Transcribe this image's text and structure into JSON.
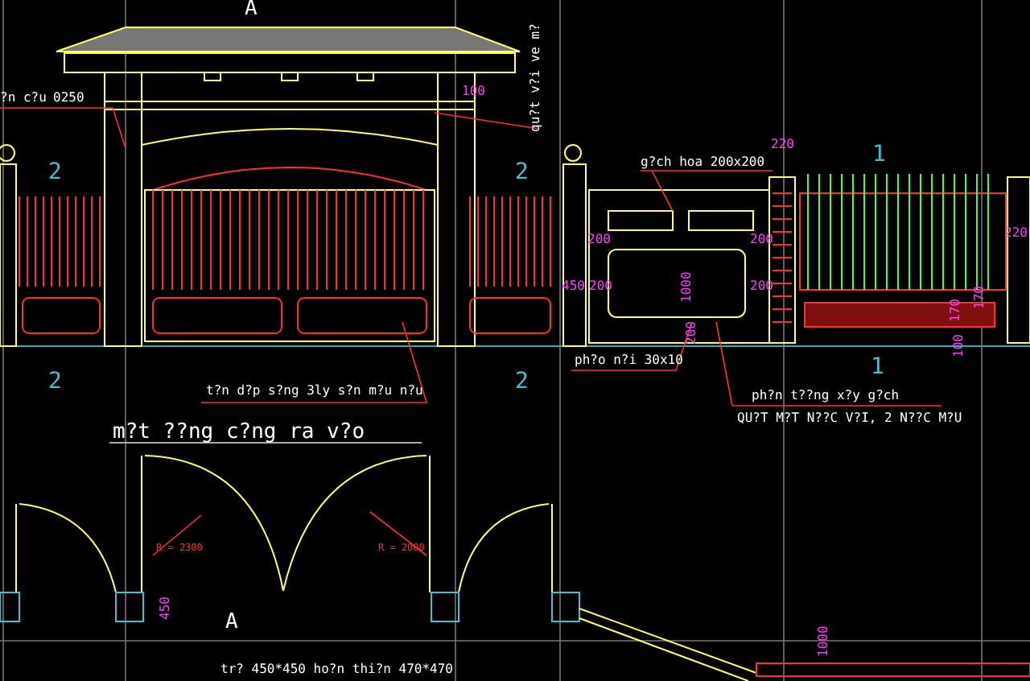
{
  "drawing": {
    "labels": [
      {
        "text": "A",
        "kind": "section"
      },
      {
        "text": "?n c?u",
        "kind": "note"
      },
      {
        "text": "0250",
        "kind": "note"
      },
      {
        "text": "100",
        "kind": "dimension"
      },
      {
        "text": "qu?t v?i ve m?",
        "kind": "note"
      },
      {
        "text": "2",
        "kind": "axis"
      },
      {
        "text": "2",
        "kind": "axis"
      },
      {
        "text": "g?ch hoa 200x200",
        "kind": "note"
      },
      {
        "text": "220",
        "kind": "dimension"
      },
      {
        "text": "1",
        "kind": "axis"
      },
      {
        "text": "220",
        "kind": "dimension"
      },
      {
        "text": "200",
        "kind": "dimension"
      },
      {
        "text": "200",
        "kind": "dimension"
      },
      {
        "text": "450",
        "kind": "dimension"
      },
      {
        "text": "200",
        "kind": "dimension"
      },
      {
        "text": "200",
        "kind": "dimension"
      },
      {
        "text": "1000",
        "kind": "dimension"
      },
      {
        "text": "200",
        "kind": "dimension"
      },
      {
        "text": "170",
        "kind": "dimension"
      },
      {
        "text": "170",
        "kind": "dimension"
      },
      {
        "text": "100",
        "kind": "dimension"
      },
      {
        "text": "2",
        "kind": "axis"
      },
      {
        "text": "2",
        "kind": "axis"
      },
      {
        "text": "t?n d?p s?ng 3ly s?n m?u n?u",
        "kind": "note"
      },
      {
        "text": "m?t ??ng c?ng ra v?o",
        "kind": "title"
      },
      {
        "text": "ph?o n?i 30x10",
        "kind": "note"
      },
      {
        "text": "1",
        "kind": "axis"
      },
      {
        "text": "ph?n t??ng x?y g?ch",
        "kind": "note"
      },
      {
        "text": "QU?T M?T N??C V?I, 2 N??C M?U",
        "kind": "note"
      },
      {
        "text": "R = 2300",
        "kind": "radius"
      },
      {
        "text": "R = 2000",
        "kind": "radius"
      },
      {
        "text": "450",
        "kind": "dimension"
      },
      {
        "text": "A",
        "kind": "section"
      },
      {
        "text": "tr? 450*450 ho?n thi?n 470*470",
        "kind": "note"
      },
      {
        "text": "1000",
        "kind": "dimension"
      }
    ]
  }
}
